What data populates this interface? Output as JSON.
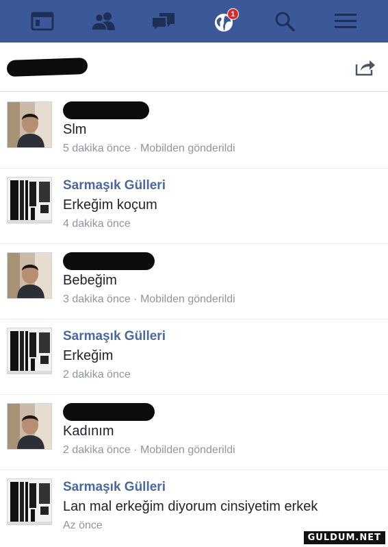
{
  "nav": {
    "notifications_count": "1",
    "icons": [
      "news-feed-icon",
      "friends-icon",
      "messages-icon",
      "notifications-globe-icon",
      "search-icon",
      "menu-icon"
    ]
  },
  "colors": {
    "topbar": "#3b5998",
    "sender_link": "#4b67a1",
    "meta_text": "#90949c",
    "badge": "#e0262c"
  },
  "messages": [
    {
      "sender": "",
      "sender_redacted": true,
      "avatar": "man-photo",
      "text": "Slm",
      "meta": "5 dakika önce · Mobilden gönderildi"
    },
    {
      "sender": "Sarmaşık Gülleri",
      "sender_redacted": false,
      "avatar": "clothes-photo",
      "text": "Erkeğim koçum",
      "meta": "4 dakika önce"
    },
    {
      "sender": "",
      "sender_redacted": true,
      "avatar": "man-photo",
      "text": "Bebeğim",
      "meta": "3 dakika önce · Mobilden gönderildi"
    },
    {
      "sender": "Sarmaşık Gülleri",
      "sender_redacted": false,
      "avatar": "clothes-photo",
      "text": "Erkeğim",
      "meta": "2 dakika önce"
    },
    {
      "sender": "",
      "sender_redacted": true,
      "avatar": "man-photo",
      "text": "Kadınım",
      "meta": "2 dakika önce · Mobilden gönderildi"
    },
    {
      "sender": "Sarmaşık Gülleri",
      "sender_redacted": false,
      "avatar": "clothes-photo",
      "text": "Lan mal erkeğim diyorum cinsiyetim erkek",
      "meta": "Az önce"
    }
  ],
  "watermark": "GULDUM.NET"
}
